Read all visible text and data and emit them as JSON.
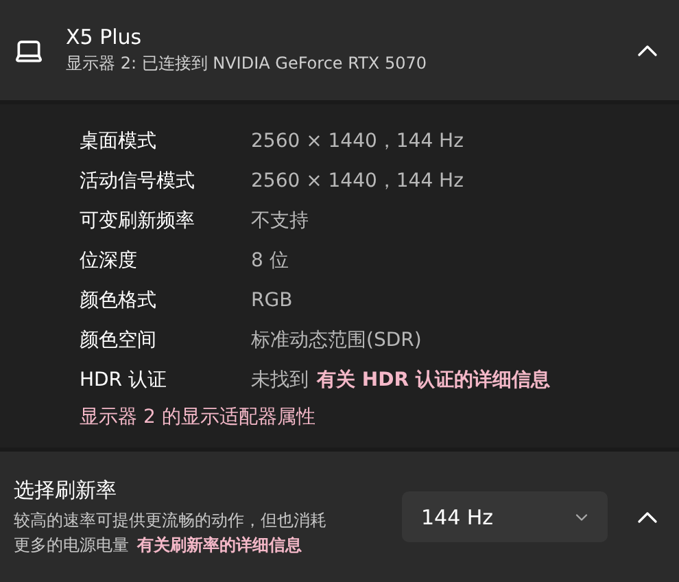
{
  "display": {
    "title": "X5 Plus",
    "subtitle": "显示器 2: 已连接到 NVIDIA GeForce RTX 5070",
    "expanded": true
  },
  "properties": [
    {
      "label": "桌面模式",
      "value": "2560 × 1440，144 Hz"
    },
    {
      "label": "活动信号模式",
      "value": "2560 × 1440，144 Hz"
    },
    {
      "label": "可变刷新频率",
      "value": "不支持"
    },
    {
      "label": "位深度",
      "value": "8 位"
    },
    {
      "label": "颜色格式",
      "value": "RGB"
    },
    {
      "label": "颜色空间",
      "value": "标准动态范围(SDR)"
    },
    {
      "label": "HDR 认证",
      "value": "未找到",
      "link": "有关 HDR 认证的详细信息"
    }
  ],
  "adapter_link": "显示器 2 的显示适配器属性",
  "refresh_rate": {
    "title": "选择刷新率",
    "description": "较高的速率可提供更流畅的动作，但也消耗更多的电源电量",
    "link": "有关刷新率的详细信息",
    "dropdown_value": "144 Hz",
    "expanded": true
  }
}
